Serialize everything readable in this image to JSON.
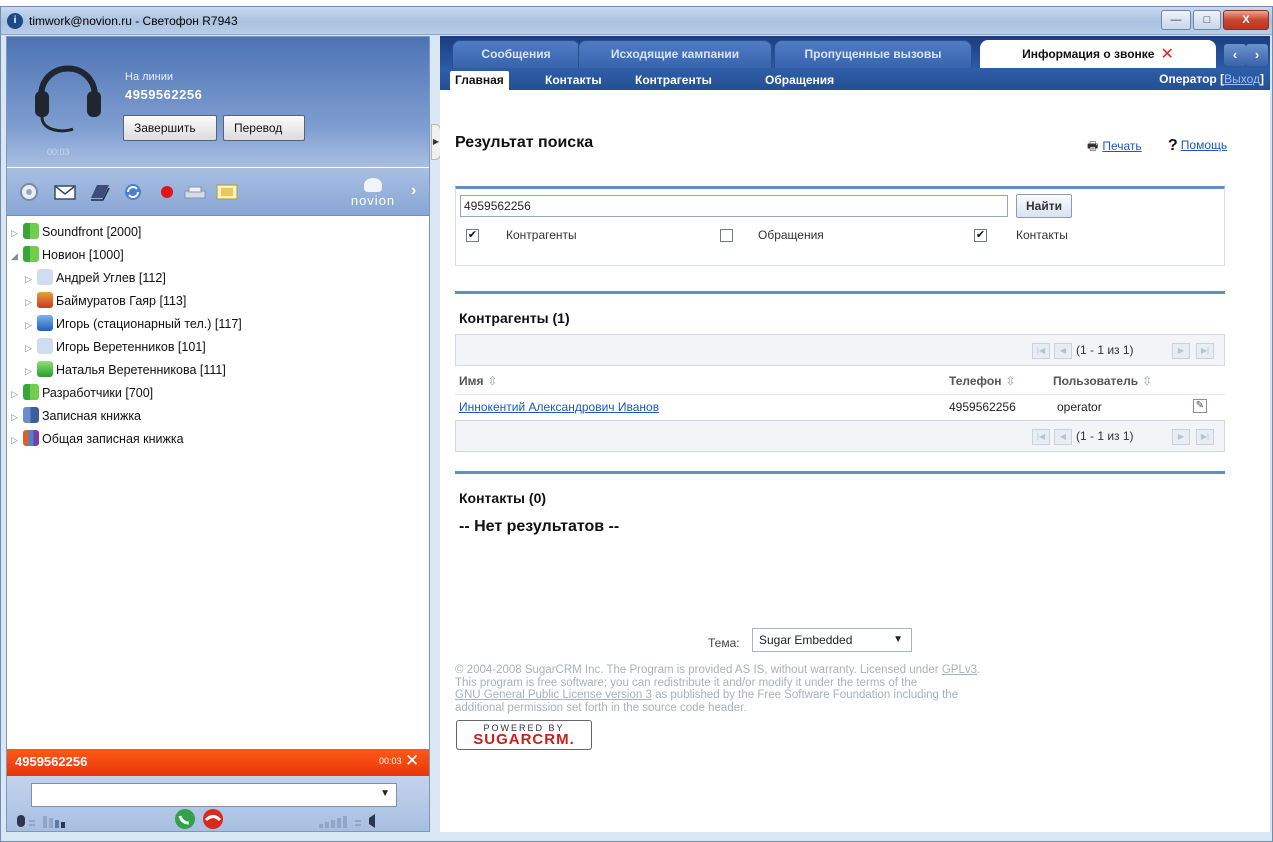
{
  "window": {
    "title": "timwork@novion.ru - Светофон R7943"
  },
  "call_panel": {
    "status": "На линии",
    "number": "4959562256",
    "end_call_label": "Завершить",
    "transfer_label": "Перевод",
    "timer": "00:03",
    "brand": "novion"
  },
  "toolbar_icons": [
    "settings-icon",
    "mail-icon",
    "notebook-icon",
    "refresh-icon",
    "record-icon",
    "fax-icon",
    "picture-icon"
  ],
  "contact_tree": [
    {
      "label": "Soundfront [2000]",
      "indent": 0,
      "arrow": "▷",
      "icon": "ico-group"
    },
    {
      "label": "Новион [1000]",
      "indent": 0,
      "arrow": "◢",
      "icon": "ico-group"
    },
    {
      "label": "Андрей Углев  [112]",
      "indent": 1,
      "arrow": "▷",
      "icon": "ico-user-pale"
    },
    {
      "label": "Баймуратов Гаяр [113]",
      "indent": 1,
      "arrow": "▷",
      "icon": "ico-user-red"
    },
    {
      "label": "Игорь (стационарный тел.) [117]",
      "indent": 1,
      "arrow": "▷",
      "icon": "ico-user-blue"
    },
    {
      "label": "Игорь Веретенников [101]",
      "indent": 1,
      "arrow": "▷",
      "icon": "ico-user-pale"
    },
    {
      "label": "Наталья Веретенникова [111]",
      "indent": 1,
      "arrow": "▷",
      "icon": "ico-user-green"
    },
    {
      "label": "Разработчики [700]",
      "indent": 0,
      "arrow": "▷",
      "icon": "ico-group"
    },
    {
      "label": "Записная книжка",
      "indent": 0,
      "arrow": "▷",
      "icon": "ico-book"
    },
    {
      "label": "Общая записная книжка",
      "indent": 0,
      "arrow": "▷",
      "icon": "ico-shared"
    }
  ],
  "active_call_bar": {
    "number": "4959562256",
    "timer": "00:03"
  },
  "tabs": [
    {
      "label": "Сообщения"
    },
    {
      "label": "Исходящие кампании"
    },
    {
      "label": "Пропущенные вызовы"
    },
    {
      "label": "Информация о звонке"
    }
  ],
  "subnav": {
    "items": [
      "Главная",
      "Контакты",
      "Контрагенты",
      "Обращения"
    ],
    "operator": "Оператор",
    "logout": "Выход"
  },
  "page": {
    "title": "Результат поиска",
    "print": "Печать",
    "help": "Помощь"
  },
  "search": {
    "value": "4959562256",
    "button": "Найти",
    "filters": [
      {
        "label": "Контрагенты",
        "checked": true
      },
      {
        "label": "Обращения",
        "checked": false
      },
      {
        "label": "Контакты",
        "checked": true
      }
    ]
  },
  "accounts": {
    "title": "Контрагенты (1)",
    "pager_text": "(1 - 1 из 1)",
    "columns": [
      "Имя",
      "Телефон",
      "Пользователь"
    ],
    "rows": [
      {
        "name": "Иннокентий Александрович Иванов",
        "phone": "4959562256",
        "user": "operator"
      }
    ]
  },
  "contacts": {
    "title": "Контакты (0)",
    "empty": "-- Нет результатов --"
  },
  "theme": {
    "label": "Тема:",
    "value": "Sugar Embedded"
  },
  "footer": {
    "line1": "© 2004-2008 SugarCRM Inc. The Program is provided AS IS, without warranty. Licensed under ",
    "gpl": "GPLv3",
    "line2": "This program is free software; you can redistribute it and/or modify it under the terms of the",
    "gnu": "GNU General Public License version 3",
    "line3": " as published by the Free Software Foundation including the",
    "line4": "additional permission set forth in the source code header.",
    "powered_by": "POWERED BY",
    "powered_brand": "SUGARCRM."
  },
  "colors": {
    "accent_blue": "#2b5aa8",
    "call_bar_orange": "#ff5a18",
    "close_red": "#e0251b",
    "link_blue": "#1f55c0"
  }
}
